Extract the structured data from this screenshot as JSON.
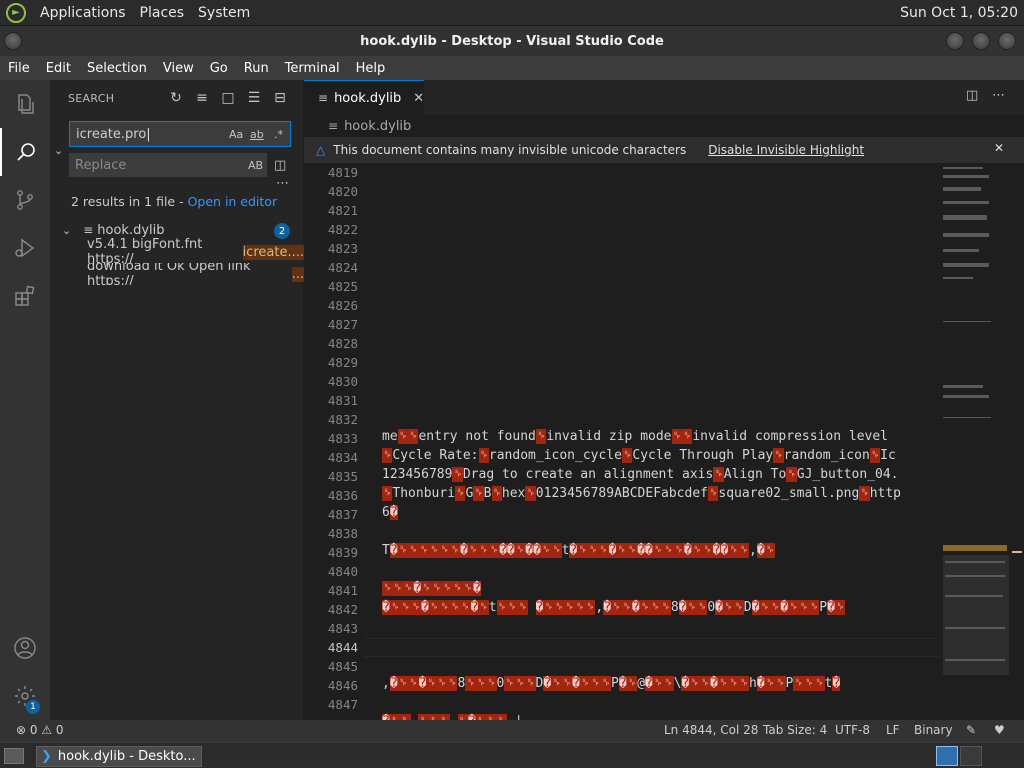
{
  "panel": {
    "applications": "Applications",
    "places": "Places",
    "system": "System",
    "clock": "Sun Oct  1, 05:20"
  },
  "window": {
    "title": "hook.dylib - Desktop - Visual Studio Code"
  },
  "menubar": [
    "File",
    "Edit",
    "Selection",
    "View",
    "Go",
    "Run",
    "Terminal",
    "Help"
  ],
  "activity": {
    "settings_badge": "1"
  },
  "search": {
    "title": "SEARCH",
    "query": "icreate.pro",
    "replace_placeholder": "Replace",
    "match_case": "Aa",
    "whole_word": "ab",
    "regex": ".*",
    "preserve_case": "AB",
    "summary": "2 results in 1 file - ",
    "open_in_editor": "Open in editor",
    "file": {
      "name": "hook.dylib",
      "count": "2"
    },
    "results": [
      {
        "prefix": "v5.4.1  bigFont.fnt  https://",
        "match": "icreate...."
      },
      {
        "prefix": "download it  Ok  Open link  https://",
        "match": "..."
      }
    ]
  },
  "editor": {
    "tab": "hook.dylib",
    "breadcrumb": "hook.dylib",
    "warning": "This document contains many invisible unicode characters",
    "warning_action": "Disable Invisible Highlight",
    "line_numbers": [
      "4819",
      "4820",
      "4821",
      "4822",
      "4823",
      "4824",
      "4825",
      "4826",
      "4827",
      "4828",
      "4829",
      "4830",
      "4831",
      "4832",
      "4833",
      "4834",
      "4835",
      "4836",
      "4837",
      "4838",
      "4839",
      "4840",
      "4841",
      "4842",
      "4843",
      "4844",
      "4845",
      "4846",
      "4847"
    ],
    "current_line": "4844",
    "lines": {
      "l4833": [
        [
          "me",
          ""
        ],
        [
          "␠␠",
          ""
        ],
        [
          "entry not found",
          ""
        ],
        [
          "␠",
          ""
        ],
        [
          "invalid zip mode",
          ""
        ],
        [
          "␠␠",
          ""
        ],
        [
          "invalid compression level",
          ""
        ]
      ],
      "l4834": [
        [
          "␠",
          ""
        ],
        [
          "Cycle Rate:",
          ""
        ],
        [
          "␠",
          ""
        ],
        [
          "random_icon_cycle",
          ""
        ],
        [
          "␠",
          ""
        ],
        [
          "Cycle Through Play",
          ""
        ],
        [
          "␠",
          ""
        ],
        [
          "random_icon",
          ""
        ],
        [
          "␠",
          ""
        ],
        [
          "Ic",
          ""
        ]
      ],
      "l4835": [
        [
          "123456789",
          ""
        ],
        [
          "␠",
          ""
        ],
        [
          "Drag to create an alignment axis",
          ""
        ],
        [
          "␠",
          ""
        ],
        [
          "Align To",
          ""
        ],
        [
          "␠",
          ""
        ],
        [
          "GJ_button_04.",
          ""
        ]
      ],
      "l4836": [
        [
          "␠",
          ""
        ],
        [
          "Thonburi",
          ""
        ],
        [
          "␠",
          ""
        ],
        [
          "G",
          ""
        ],
        [
          "␠",
          ""
        ],
        [
          "B",
          ""
        ],
        [
          "␠",
          ""
        ],
        [
          "hex",
          ""
        ],
        [
          "␠",
          ""
        ],
        [
          "0123456789ABCDEFabcdef",
          ""
        ],
        [
          "␠",
          ""
        ],
        [
          "square02_small.png",
          ""
        ],
        [
          "␠",
          ""
        ],
        [
          "http",
          ""
        ]
      ],
      "l4837": "6�",
      "l4839": "T�␠␠␠␠␠␠�␠␠␠��␠��␠␠t�␠␠␠�␠␠��␠␠␠�␠␠��␠␠,�␠",
      "l4841": "␠␠␠�␠␠␠␠␠�",
      "l4842": "�␠␠␠�␠␠␠␠�␠t␠␠␠ �␠␠␠␠␠,�␠␠�␠␠␠8�␠␠0�␠␠D�␠␠�␠␠␠P�␠",
      "l4846": ",�␠␠�␠␠␠8␠␠␠0␠␠␠D�␠␠�␠␠␠P�␠@�␠␠\\�␠␠�␠␠␠h�␠␠P␠␠␠t�",
      "l4848": "�␠␠ ␠␠␠ ␠�␠␠␠ |"
    }
  },
  "status": {
    "problems": "⊗ 0 ⚠ 0",
    "position": "Ln 4844, Col 28",
    "tab_size": "Tab Size: 4",
    "encoding": "UTF-8",
    "eol": "LF",
    "language": "Binary"
  },
  "taskbar": {
    "task_label": "hook.dylib - Deskto..."
  },
  "colors": {
    "accent": "#007acc",
    "highlight": "#a1260d",
    "match": "#613214"
  }
}
